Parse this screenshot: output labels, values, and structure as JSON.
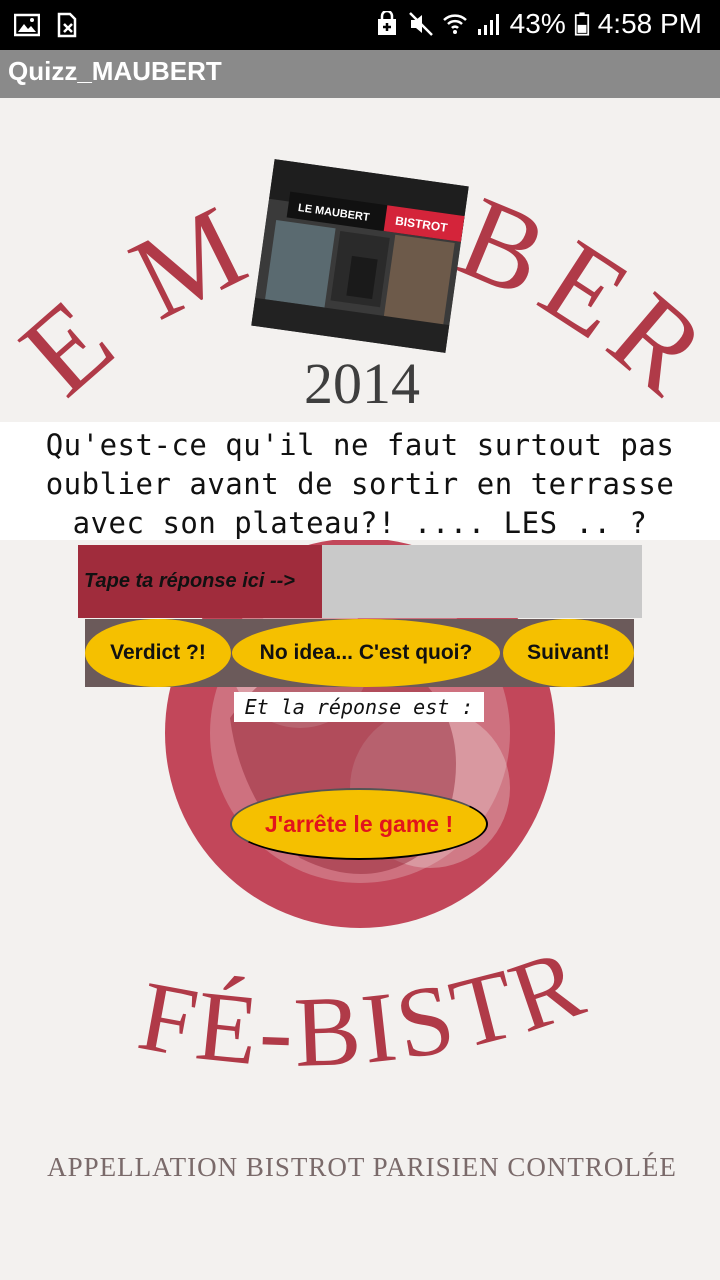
{
  "status_bar": {
    "battery": "43%",
    "time": "4:58 PM"
  },
  "app": {
    "title": "Quizz_MAUBERT"
  },
  "background": {
    "brand_top": "LE MAUBERT",
    "year": "2014",
    "brand_bottom": "CAFÉ-BISTROT",
    "tagline": "APPELLATION BISTROT PARISIEN CONTROLÉE",
    "photo_sign_left": "LE MAUBERT",
    "photo_sign_right": "BISTROT"
  },
  "quiz": {
    "question": "Qu'est-ce qu'il ne faut surtout pas oublier avant de sortir en terrasse avec son plateau?! .... LES .. ?",
    "answer_label": "Tape ta réponse ici -->",
    "answer_value": "",
    "verdict_button": "Verdict ?!",
    "no_idea_button": "No idea... C'est quoi?",
    "next_button": "Suivant!",
    "result_label": "Et la réponse est :",
    "quit_button": "J'arrête le game !"
  },
  "colors": {
    "accent_red": "#a02c3c",
    "button_yellow": "#f5c000",
    "quit_text": "#e2141c"
  }
}
